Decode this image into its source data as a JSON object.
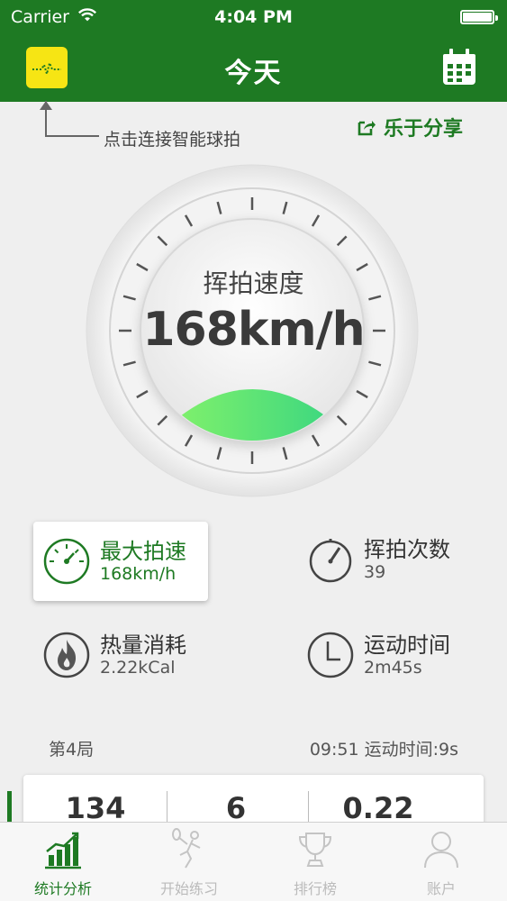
{
  "status": {
    "carrier": "Carrier",
    "time": "4:04 PM"
  },
  "nav": {
    "title": "今天"
  },
  "hint": {
    "text": "点击连接智能球拍"
  },
  "share": {
    "label": "乐于分享"
  },
  "gauge": {
    "title": "挥拍速度",
    "value": "168km/h"
  },
  "stats": [
    {
      "label": "最大拍速",
      "value": "168km/h",
      "icon": "speedometer-icon"
    },
    {
      "label": "挥拍次数",
      "value": "39",
      "icon": "stopwatch-icon"
    },
    {
      "label": "热量消耗",
      "value": "2.22kCal",
      "icon": "flame-icon"
    },
    {
      "label": "运动时间",
      "value": "2m45s",
      "icon": "clock-icon"
    }
  ],
  "game": {
    "title": "第4局",
    "meta": "09:51 运动时间:9s",
    "values": [
      "134",
      "6",
      "0.22"
    ]
  },
  "tabs": [
    {
      "label": "统计分析",
      "icon": "bar-chart-icon"
    },
    {
      "label": "开始练习",
      "icon": "player-icon"
    },
    {
      "label": "排行榜",
      "icon": "trophy-icon"
    },
    {
      "label": "账户",
      "icon": "user-icon"
    }
  ],
  "colors": {
    "brand": "#1e7a23",
    "connect": "#f6e514"
  }
}
